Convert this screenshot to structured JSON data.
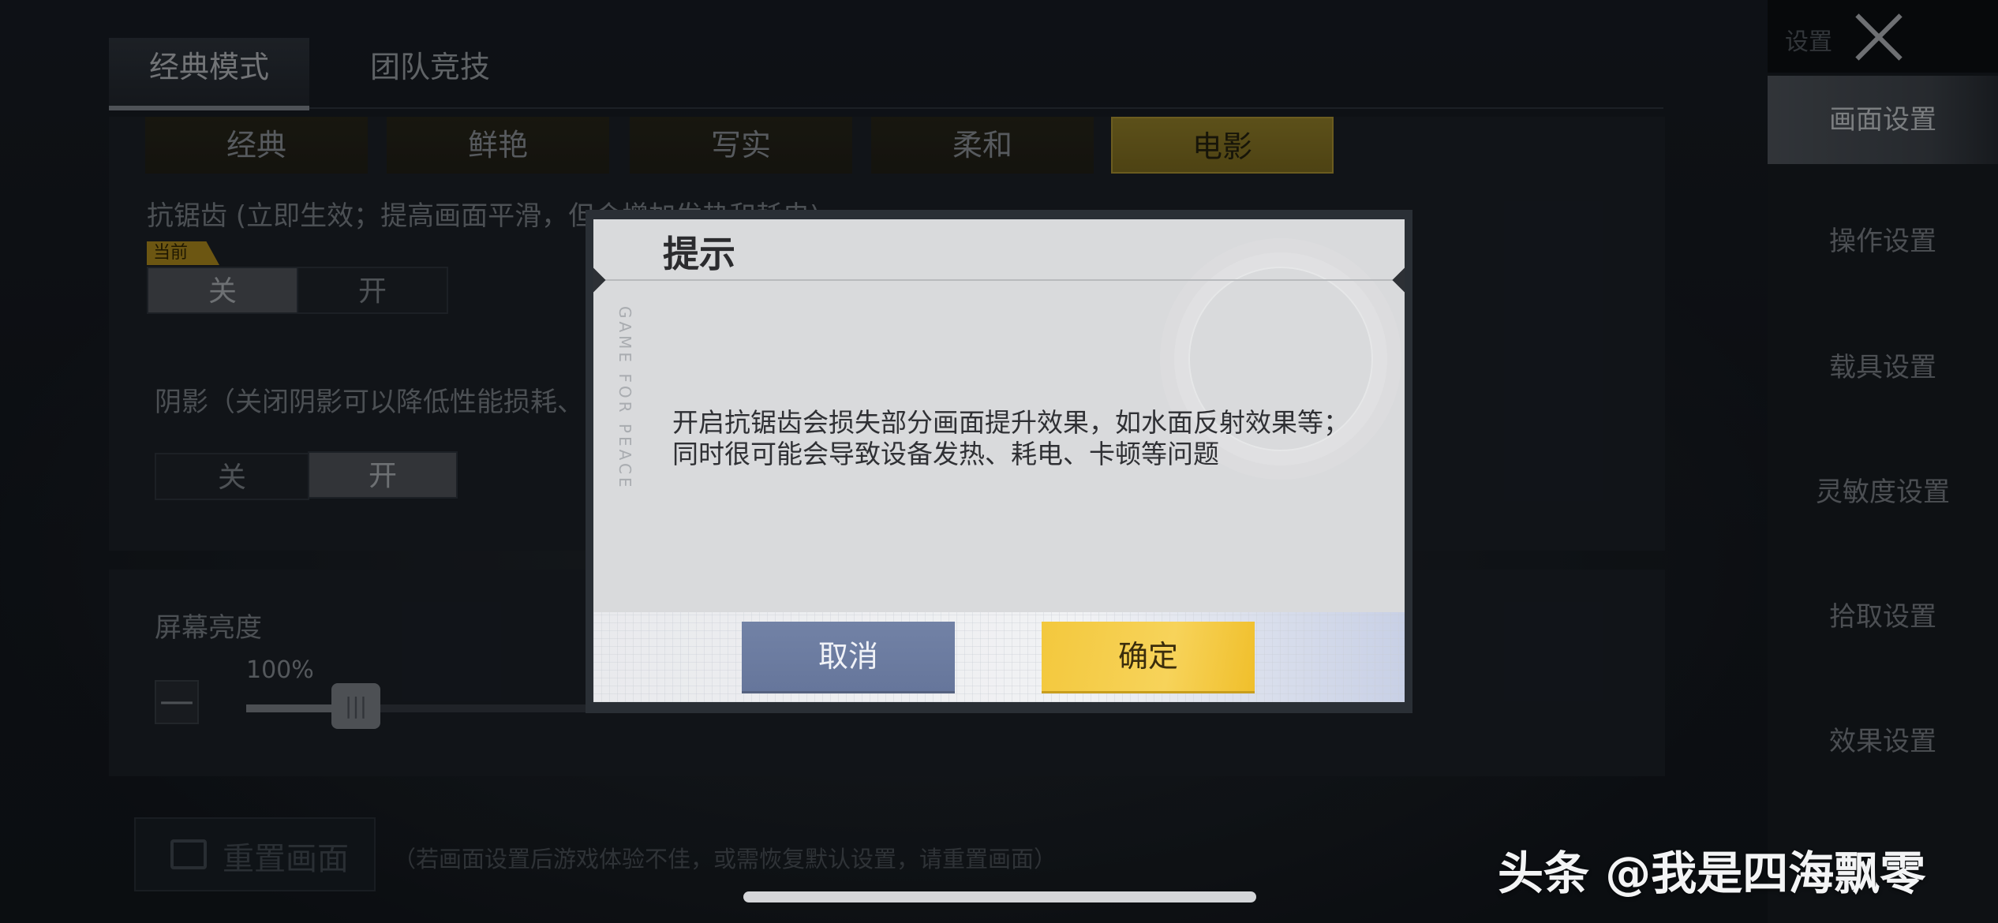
{
  "tabs": [
    "经典模式",
    "团队竞技"
  ],
  "presets": [
    "经典",
    "鲜艳",
    "写实",
    "柔和",
    "电影"
  ],
  "antialias": {
    "label": "抗锯齿 (立即生效；提高画面平滑，但会增加发热和耗电)",
    "current_tag": "当前",
    "off": "关",
    "on": "开"
  },
  "shadow": {
    "label": "阴影（关闭阴影可以降低性能损耗、",
    "off": "关",
    "on": "开"
  },
  "brightness": {
    "label": "屏幕亮度",
    "value": "100%",
    "minus": "—",
    "thumb_glyph": "|||"
  },
  "reset": {
    "label": "重置画面",
    "hint": "（若画面设置后游戏体验不佳，或需恢复默认设置，请重置画面）"
  },
  "sidebar": {
    "title": "设置",
    "items": [
      "画面设置",
      "操作设置",
      "载具设置",
      "灵敏度设置",
      "拾取设置",
      "效果设置"
    ]
  },
  "dialog": {
    "title": "提示",
    "body": "开启抗锯齿会损失部分画面提升效果，如水面反射效果等；同时很可能会导致设备发热、耗电、卡顿等问题",
    "watermark": "GAME FOR PEACE",
    "cancel": "取消",
    "confirm": "确定"
  },
  "attribution": "头条 @我是四海飘零",
  "colors": {
    "accent_gold": "#f3c83d",
    "cancel_blue": "#6b7ba0",
    "active_sidebar": "#5a6068"
  }
}
